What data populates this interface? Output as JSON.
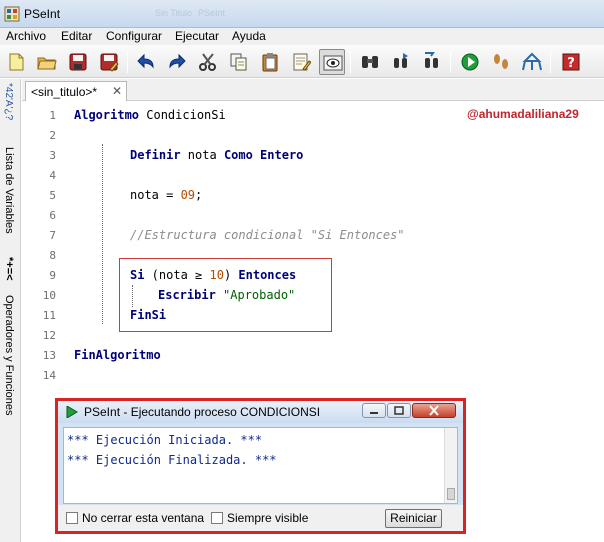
{
  "window": {
    "title": "PSeInt",
    "ghost_title": [
      "Sin Titulo",
      "PSeInt"
    ]
  },
  "menu": [
    "Archivo",
    "Editar",
    "Configurar",
    "Ejecutar",
    "Ayuda"
  ],
  "sidebar": {
    "variables_label": "Lista de Variables",
    "variables_glyph": "*42'A'¿?",
    "operators_label": "Operadores y Funciones",
    "operators_glyph": "*+=<"
  },
  "tab": {
    "label": "<sin_titulo>*",
    "close": "✕"
  },
  "editor": {
    "watermark": "@ahumadaliliana29",
    "line_numbers": [
      "1",
      "2",
      "3",
      "4",
      "5",
      "6",
      "7",
      "8",
      "9",
      "10",
      "11",
      "12",
      "13",
      "14"
    ],
    "code": {
      "l1_kw": "Algoritmo",
      "l1_name": " CondicionSi",
      "l3_kw1": "Definir",
      "l3_var": " nota ",
      "l3_kw2": "Como Entero",
      "l5_text": "nota = ",
      "l5_num": "09",
      "l5_end": ";",
      "l7_comment": "//Estructura condicional \"Si Entonces\"",
      "l9_kw1": "Si",
      "l9_a": " (nota ≥ ",
      "l9_num": "10",
      "l9_b": ") ",
      "l9_kw2": "Entonces",
      "l10_kw": "Escribir",
      "l10_str": " \"Aprobado\"",
      "l11_kw": "FinSi",
      "l13_kw": "FinAlgoritmo"
    }
  },
  "dialog": {
    "title": "PSeInt - Ejecutando proceso CONDICIONSI",
    "output": [
      "*** Ejecución Iniciada. ***",
      "*** Ejecución Finalizada. ***"
    ],
    "checkbox_keep_open": "No cerrar esta ventana",
    "checkbox_always_visible": "Siempre visible",
    "reset_button": "Reiniciar"
  },
  "colors": {
    "accent_red": "#d92424",
    "keyword": "#00007a",
    "number": "#b34b00",
    "string": "#006000",
    "comment": "#8c8c8c",
    "output": "#102a8c"
  }
}
